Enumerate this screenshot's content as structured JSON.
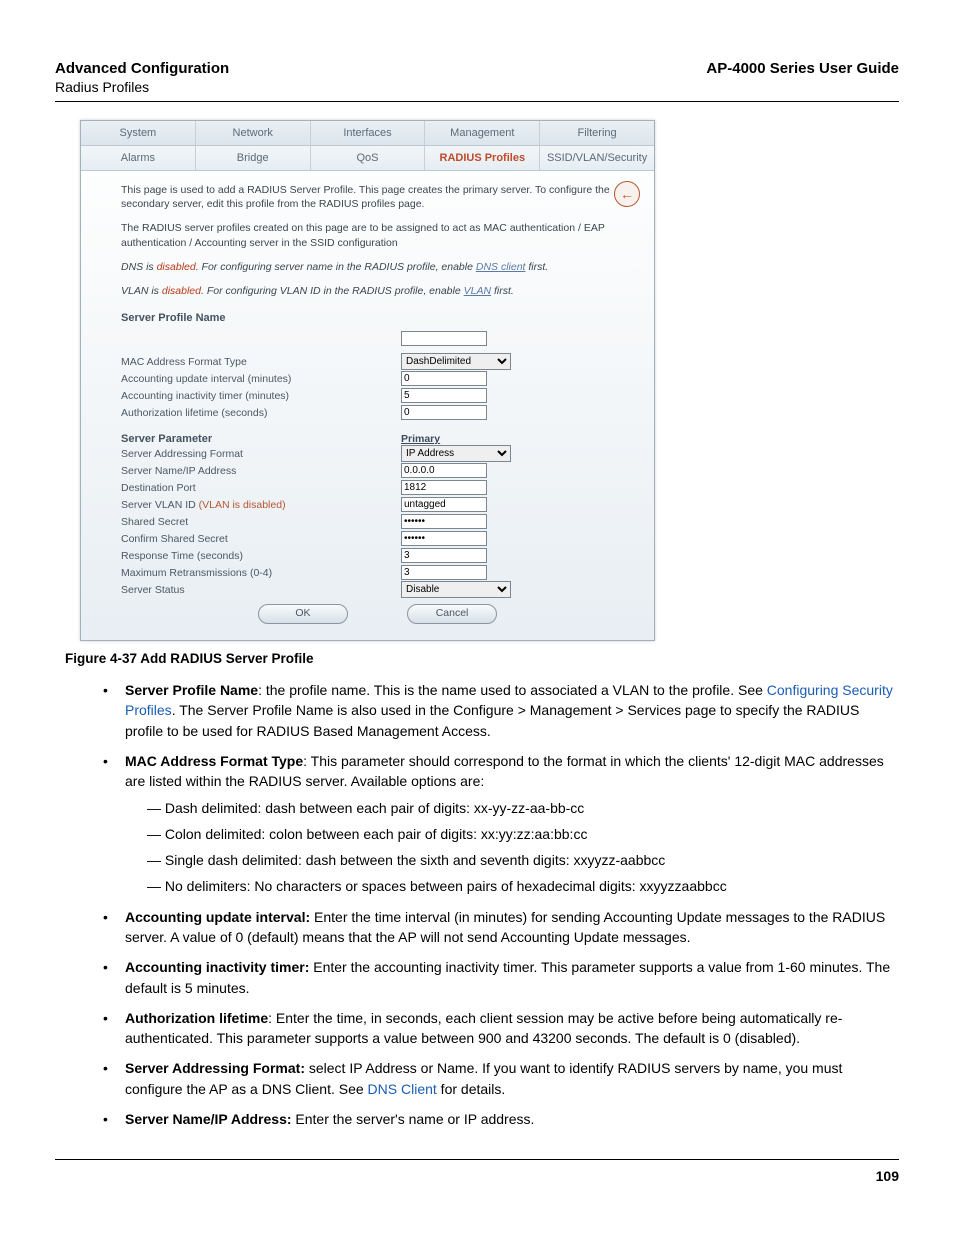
{
  "header": {
    "title": "Advanced Configuration",
    "subtitle": "Radius Profiles",
    "guide": "AP-4000 Series User Guide"
  },
  "tabs": {
    "row1": [
      "System",
      "Network",
      "Interfaces",
      "Management",
      "Filtering"
    ],
    "row2": [
      "Alarms",
      "Bridge",
      "QoS",
      "RADIUS Profiles",
      "SSID/VLAN/Security"
    ],
    "active": "RADIUS Profiles"
  },
  "intro": {
    "p1": "This page is used to add a RADIUS Server Profile. This page creates the primary server. To configure the secondary server, edit this profile from the RADIUS profiles page.",
    "p2": "The RADIUS server profiles created on this page are to be assigned to act as MAC authentication / EAP authentication / Accounting server in the SSID configuration",
    "p3_pre": "DNS is ",
    "p3_dis": "disabled",
    "p3_mid": ". For configuring server name in the RADIUS profile, enable ",
    "p3_link": "DNS client",
    "p3_post": " first.",
    "p4_pre": "VLAN is ",
    "p4_dis": "disabled",
    "p4_mid": ". For configuring VLAN ID in the RADIUS profile, enable ",
    "p4_link": "VLAN",
    "p4_post": " first."
  },
  "form": {
    "sectionA": "Server Profile Name",
    "rows1": [
      {
        "label": "MAC Address Format Type",
        "type": "select",
        "value": "DashDelimited"
      },
      {
        "label": "Accounting update interval (minutes)",
        "type": "text",
        "value": "0"
      },
      {
        "label": "Accounting inactivity timer (minutes)",
        "type": "text",
        "value": "5"
      },
      {
        "label": "Authorization lifetime (seconds)",
        "type": "text",
        "value": "0"
      }
    ],
    "sectionB": "Server Parameter",
    "colHeader": "Primary",
    "rows2": [
      {
        "label": "Server Addressing Format",
        "type": "select",
        "value": "IP Address"
      },
      {
        "label": "Server Name/IP Address",
        "type": "text",
        "value": "0.0.0.0"
      },
      {
        "label": "Destination Port",
        "type": "text",
        "value": "1812"
      },
      {
        "label": "Server VLAN ID (VLAN is disabled)",
        "type": "text",
        "value": "untagged",
        "disabledHint": true
      },
      {
        "label": "Shared Secret",
        "type": "password",
        "value": "******"
      },
      {
        "label": "Confirm Shared Secret",
        "type": "password",
        "value": "******"
      },
      {
        "label": "Response Time (seconds)",
        "type": "text",
        "value": "3"
      },
      {
        "label": "Maximum Retransmissions (0-4)",
        "type": "text",
        "value": "3"
      },
      {
        "label": "Server Status",
        "type": "select",
        "value": "Disable"
      }
    ],
    "buttons": {
      "ok": "OK",
      "cancel": "Cancel"
    }
  },
  "figureCaption": "Figure 4-37 Add RADIUS Server Profile",
  "bullets": [
    {
      "term": "Server Profile Name",
      "text_a": ": the profile name. This is the name used to associated a VLAN to the profile. See ",
      "link": "Configuring Security Profiles",
      "text_b": ". The Server Profile Name is also used in the Configure > Management > Services page to specify the RADIUS profile to be used for RADIUS Based Management Access."
    },
    {
      "term": "MAC Address Format Type",
      "text_a": ": This parameter should correspond to the format in which the clients' 12-digit MAC addresses are listed within the RADIUS server. Available options are:",
      "subs": [
        "Dash delimited: dash between each pair of digits: xx-yy-zz-aa-bb-cc",
        "Colon delimited: colon between each pair of digits: xx:yy:zz:aa:bb:cc",
        "Single dash delimited: dash between the sixth and seventh digits: xxyyzz-aabbcc",
        "No delimiters: No characters or spaces between pairs of hexadecimal digits: xxyyzzaabbcc"
      ]
    },
    {
      "term": "Accounting update interval:",
      "text_a": " Enter the time interval (in minutes) for sending Accounting Update messages to the RADIUS server. A value of 0 (default) means that the AP will not send Accounting Update messages."
    },
    {
      "term": "Accounting inactivity timer:",
      "text_a": " Enter the accounting inactivity timer. This parameter supports a value from 1-60 minutes. The default is 5 minutes."
    },
    {
      "term": "Authorization lifetime",
      "text_a": ": Enter the time, in seconds, each client session may be active before being automatically re-authenticated. This parameter supports a value between 900 and 43200 seconds. The default is 0 (disabled)."
    },
    {
      "term": "Server Addressing Format:",
      "text_a": " select IP Address or Name. If you want to identify RADIUS servers by name, you must configure the AP as a DNS Client. See ",
      "link": "DNS Client",
      "text_b": " for details."
    },
    {
      "term": "Server Name/IP Address:",
      "text_a": " Enter the server's name or IP address."
    }
  ],
  "pageNumber": "109"
}
